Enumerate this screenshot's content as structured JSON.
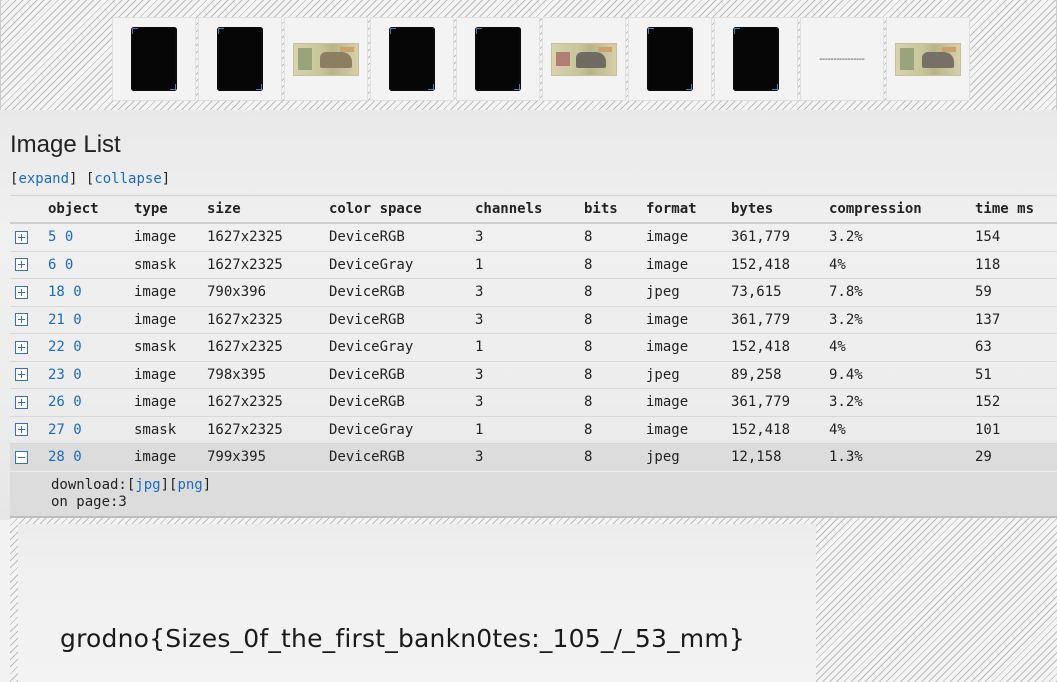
{
  "thumbnails": [
    {
      "kind": "card"
    },
    {
      "kind": "card"
    },
    {
      "kind": "banknote",
      "variant": "a"
    },
    {
      "kind": "card"
    },
    {
      "kind": "card"
    },
    {
      "kind": "banknote",
      "variant": "b"
    },
    {
      "kind": "card"
    },
    {
      "kind": "card"
    },
    {
      "kind": "text"
    },
    {
      "kind": "banknote",
      "variant": "c"
    }
  ],
  "page_title": "Image List",
  "toggles": {
    "expand": "expand",
    "collapse": "collapse"
  },
  "table": {
    "headers": [
      "object",
      "type",
      "size",
      "color space",
      "channels",
      "bits",
      "format",
      "bytes",
      "compression",
      "time ms"
    ],
    "rows": [
      {
        "object": "5 0",
        "type": "image",
        "size": "1627x2325",
        "color_space": "DeviceRGB",
        "channels": "3",
        "bits": "8",
        "format": "image",
        "bytes": "361,779",
        "compression": "3.2%",
        "time_ms": "154",
        "expanded": false
      },
      {
        "object": "6 0",
        "type": "smask",
        "size": "1627x2325",
        "color_space": "DeviceGray",
        "channels": "1",
        "bits": "8",
        "format": "image",
        "bytes": "152,418",
        "compression": "4%",
        "time_ms": "118",
        "expanded": false
      },
      {
        "object": "18 0",
        "type": "image",
        "size": "790x396",
        "color_space": "DeviceRGB",
        "channels": "3",
        "bits": "8",
        "format": "jpeg",
        "bytes": "73,615",
        "compression": "7.8%",
        "time_ms": "59",
        "expanded": false
      },
      {
        "object": "21 0",
        "type": "image",
        "size": "1627x2325",
        "color_space": "DeviceRGB",
        "channels": "3",
        "bits": "8",
        "format": "image",
        "bytes": "361,779",
        "compression": "3.2%",
        "time_ms": "137",
        "expanded": false
      },
      {
        "object": "22 0",
        "type": "smask",
        "size": "1627x2325",
        "color_space": "DeviceGray",
        "channels": "1",
        "bits": "8",
        "format": "image",
        "bytes": "152,418",
        "compression": "4%",
        "time_ms": "63",
        "expanded": false
      },
      {
        "object": "23 0",
        "type": "image",
        "size": "798x395",
        "color_space": "DeviceRGB",
        "channels": "3",
        "bits": "8",
        "format": "jpeg",
        "bytes": "89,258",
        "compression": "9.4%",
        "time_ms": "51",
        "expanded": false
      },
      {
        "object": "26 0",
        "type": "image",
        "size": "1627x2325",
        "color_space": "DeviceRGB",
        "channels": "3",
        "bits": "8",
        "format": "image",
        "bytes": "361,779",
        "compression": "3.2%",
        "time_ms": "152",
        "expanded": false
      },
      {
        "object": "27 0",
        "type": "smask",
        "size": "1627x2325",
        "color_space": "DeviceGray",
        "channels": "1",
        "bits": "8",
        "format": "image",
        "bytes": "152,418",
        "compression": "4%",
        "time_ms": "101",
        "expanded": false
      },
      {
        "object": "28 0",
        "type": "image",
        "size": "799x395",
        "color_space": "DeviceRGB",
        "channels": "3",
        "bits": "8",
        "format": "jpeg",
        "bytes": "12,158",
        "compression": "1.3%",
        "time_ms": "29",
        "expanded": true
      }
    ]
  },
  "details": {
    "download_label": "download:",
    "jpg": "jpg",
    "png": "png",
    "on_page": "on page:3"
  },
  "flag_text": "grodno{Sizes_0f_the_first_bankn0tes:_105_/_53_mm}"
}
